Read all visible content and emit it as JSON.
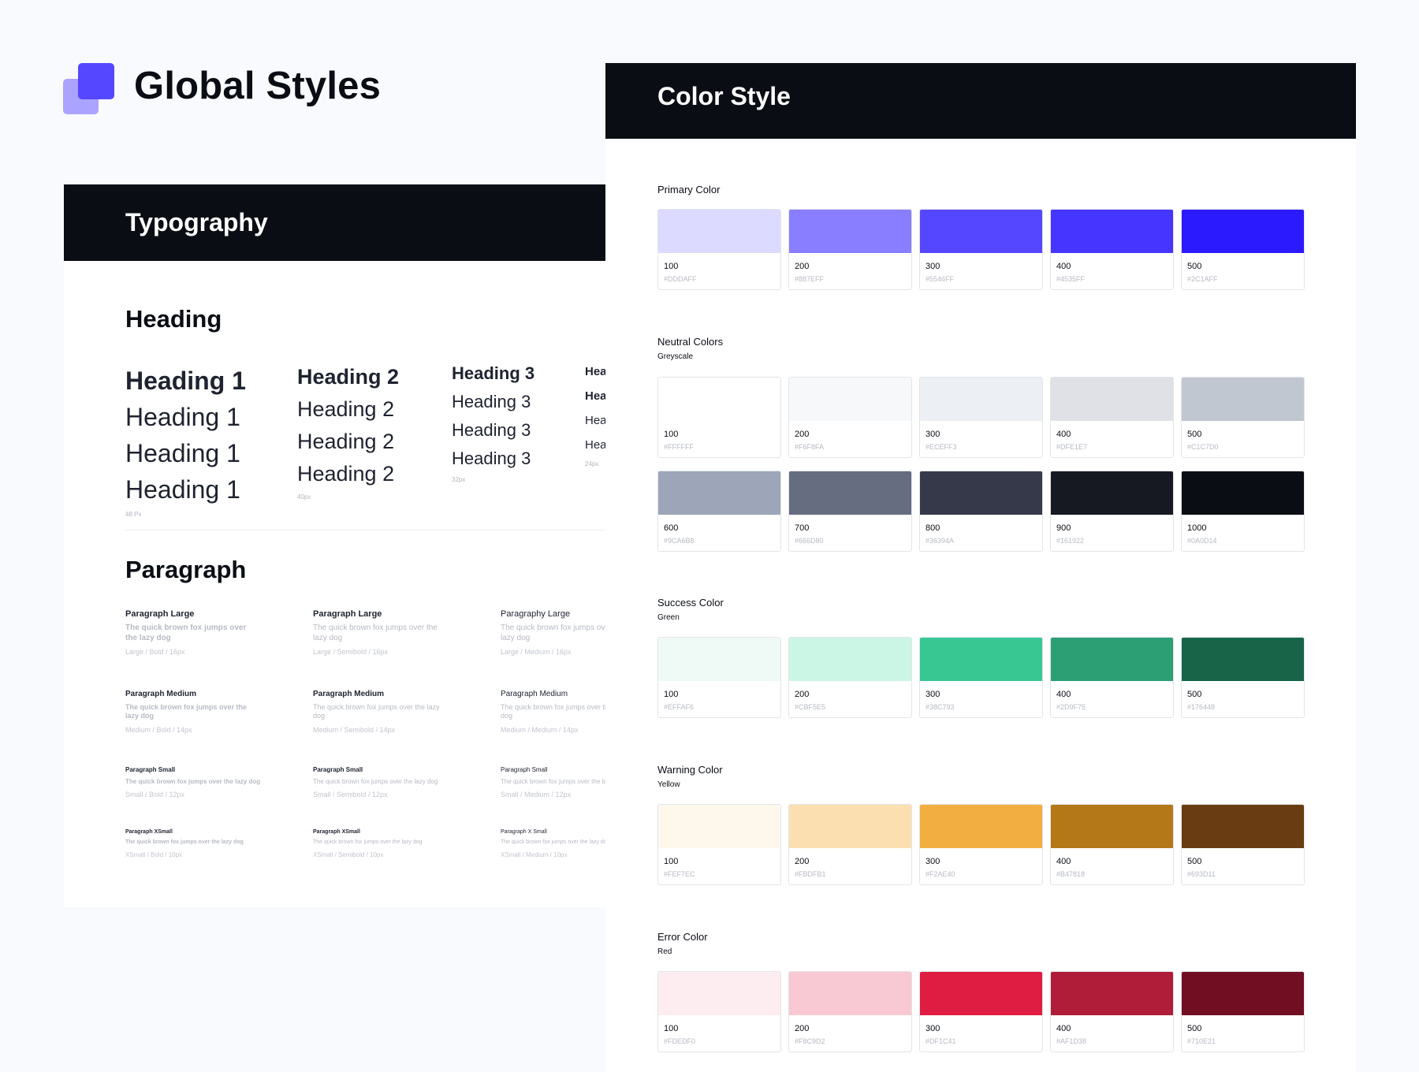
{
  "brand": {
    "title": "Global Styles",
    "logo_colors": {
      "front": "#5546FF",
      "back": "#AAA3FF"
    }
  },
  "typography": {
    "band_title": "Typography",
    "heading_section": "Heading",
    "heading_columns": [
      {
        "items": [
          "Heading 1",
          "Heading 1",
          "Heading 1",
          "Heading 1"
        ],
        "size": "48 Px"
      },
      {
        "items": [
          "Heading 2",
          "Heading 2",
          "Heading 2",
          "Heading 2"
        ],
        "size": "40px"
      },
      {
        "items": [
          "Heading 3",
          "Heading 3",
          "Heading 3",
          "Heading 3"
        ],
        "size": "32px"
      },
      {
        "items": [
          "Hea",
          "Hea",
          "Hea",
          "Hea"
        ],
        "size": "24px"
      }
    ],
    "paragraph_section": "Paragraph",
    "paragraph_columns": [
      {
        "groups": [
          {
            "label": "Paragraph Large",
            "text": "The quick brown fox jumps over the lazy dog",
            "spec": "Large / Bold / 16px"
          },
          {
            "label": "Paragraph Medium",
            "text": "The quick brown fox jumps over the lazy dog",
            "spec": "Medium / Bold / 14px"
          },
          {
            "label": "Paragraph Small",
            "text": "The quick brown fox jumps over the lazy dog",
            "spec": "Small / Bold / 12px"
          },
          {
            "label": "Paragraph XSmall",
            "text": "The quick brown fox jumps over the lazy dog",
            "spec": "XSmall / Bold / 10px"
          }
        ]
      },
      {
        "groups": [
          {
            "label": "Paragraph Large",
            "text": "The quick brown fox jumps over the lazy dog",
            "spec": "Large / Semibold / 16px"
          },
          {
            "label": "Paragraph Medium",
            "text": "The quick brown fox jumps over the lazy dog",
            "spec": "Medium / Semibold / 14px"
          },
          {
            "label": "Paragraph Small",
            "text": "The quick brown fox jumps over the lazy dog",
            "spec": "Small / Semibold / 12px"
          },
          {
            "label": "Paragraph XSmall",
            "text": "The quick brown fox jumps over the lazy dog",
            "spec": "XSmall / Semibold / 10px"
          }
        ]
      },
      {
        "groups": [
          {
            "label": "Paragraphy Large",
            "text": "The quick brown fox jumps over the lazy dog",
            "spec": "Large / Medium / 16px"
          },
          {
            "label": "Paragraph Medium",
            "text": "The quick brown fox jumps over the lazy dog",
            "spec": "Medium / Medium / 14px"
          },
          {
            "label": "Paragraph Small",
            "text": "The quick brown fox jumps over the lazy dog",
            "spec": "Small / Medium / 12px"
          },
          {
            "label": "Paragraph X Small",
            "text": "The quick brown fox jumps over the lazy dog",
            "spec": "XSmall / Medium / 10px"
          }
        ]
      }
    ]
  },
  "color_style": {
    "band_title": "Color Style",
    "groups": [
      {
        "title": "Primary Color",
        "subtitle": "",
        "rows": [
          [
            {
              "level": "100",
              "hex": "#DDDAFF"
            },
            {
              "level": "200",
              "hex": "#887EFF"
            },
            {
              "level": "300",
              "hex": "#5546FF"
            },
            {
              "level": "400",
              "hex": "#4535FF"
            },
            {
              "level": "500",
              "hex": "#2C1AFF"
            }
          ]
        ]
      },
      {
        "title": "Neutral Colors",
        "subtitle": "Greyscale",
        "rows": [
          [
            {
              "level": "100",
              "hex": "#FFFFFF"
            },
            {
              "level": "200",
              "hex": "#F6F8FA"
            },
            {
              "level": "300",
              "hex": "#ECEFF3"
            },
            {
              "level": "400",
              "hex": "#DFE1E7"
            },
            {
              "level": "500",
              "hex": "#C1C7D0"
            }
          ],
          [
            {
              "level": "600",
              "hex": "#9CA6B8"
            },
            {
              "level": "700",
              "hex": "#666D80"
            },
            {
              "level": "800",
              "hex": "#36394A"
            },
            {
              "level": "900",
              "hex": "#161922"
            },
            {
              "level": "1000",
              "hex": "#0A0D14"
            }
          ]
        ]
      },
      {
        "title": "Success Color",
        "subtitle": "Green",
        "rows": [
          [
            {
              "level": "100",
              "hex": "#EFFAF6"
            },
            {
              "level": "200",
              "hex": "#CBF5E5"
            },
            {
              "level": "300",
              "hex": "#38C793"
            },
            {
              "level": "400",
              "hex": "#2D9F75"
            },
            {
              "level": "500",
              "hex": "#176448"
            }
          ]
        ]
      },
      {
        "title": "Warning Color",
        "subtitle": "Yellow",
        "rows": [
          [
            {
              "level": "100",
              "hex": "#FEF7EC"
            },
            {
              "level": "200",
              "hex": "#FBDFB1"
            },
            {
              "level": "300",
              "hex": "#F2AE40"
            },
            {
              "level": "400",
              "hex": "#B47818"
            },
            {
              "level": "500",
              "hex": "#693D11"
            }
          ]
        ]
      },
      {
        "title": "Error Color",
        "subtitle": "Red",
        "rows": [
          [
            {
              "level": "100",
              "hex": "#FDEDF0"
            },
            {
              "level": "200",
              "hex": "#F8C9D2"
            },
            {
              "level": "300",
              "hex": "#DF1C41"
            },
            {
              "level": "400",
              "hex": "#AF1D38"
            },
            {
              "level": "500",
              "hex": "#710E21"
            }
          ]
        ]
      }
    ]
  }
}
